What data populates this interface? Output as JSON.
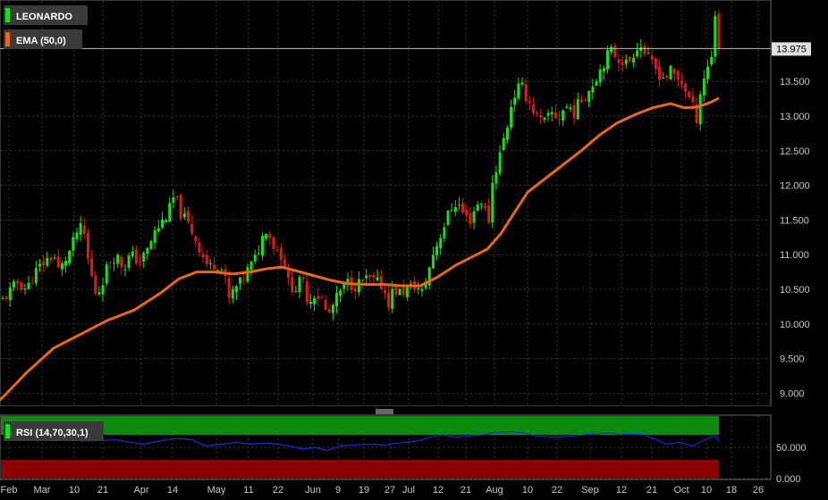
{
  "chart_data": [
    {
      "type": "candlestick",
      "symbol": "LEONARDO",
      "overlay_label": "EMA (50,0)",
      "last_price": "13.975",
      "ylim": [
        8.85,
        14.65
      ],
      "yticks": [
        "9.000",
        "9.500",
        "10.000",
        "10.500",
        "11.000",
        "11.500",
        "12.000",
        "12.500",
        "13.000",
        "13.500"
      ],
      "ytick_values": [
        9.0,
        9.5,
        10.0,
        10.5,
        11.0,
        11.5,
        12.0,
        12.5,
        13.0,
        13.5
      ],
      "xticks": [
        "Feb",
        "Mar",
        "10",
        "21",
        "Apr",
        "14",
        "May",
        "11",
        "22",
        "Jun",
        "9",
        "19",
        "27",
        "Jul",
        "12",
        "21",
        "Aug",
        "10",
        "22",
        "Sep",
        "12",
        "21",
        "Oct",
        "10",
        "18",
        "26"
      ],
      "colors": {
        "up": "#18e018",
        "down": "#e01818",
        "ema": "#e8671c",
        "grid": "#3a3a3a"
      },
      "close_path": [
        [
          0,
          10.3
        ],
        [
          10,
          10.45
        ],
        [
          20,
          10.6
        ],
        [
          30,
          10.5
        ],
        [
          40,
          10.75
        ],
        [
          50,
          10.9
        ],
        [
          60,
          11.0
        ],
        [
          66,
          10.75
        ],
        [
          72,
          10.9
        ],
        [
          80,
          11.1
        ],
        [
          88,
          11.4
        ],
        [
          94,
          11.3
        ],
        [
          100,
          10.8
        ],
        [
          108,
          10.4
        ],
        [
          114,
          10.6
        ],
        [
          122,
          10.9
        ],
        [
          130,
          11.0
        ],
        [
          138,
          10.8
        ],
        [
          146,
          11.0
        ],
        [
          155,
          10.9
        ],
        [
          163,
          11.0
        ],
        [
          172,
          11.3
        ],
        [
          180,
          11.45
        ],
        [
          188,
          11.6
        ],
        [
          195,
          11.85
        ],
        [
          202,
          11.6
        ],
        [
          210,
          11.45
        ],
        [
          218,
          11.25
        ],
        [
          226,
          11.0
        ],
        [
          234,
          10.8
        ],
        [
          242,
          10.9
        ],
        [
          250,
          10.75
        ],
        [
          256,
          10.35
        ],
        [
          262,
          10.5
        ],
        [
          270,
          10.6
        ],
        [
          278,
          10.8
        ],
        [
          286,
          10.95
        ],
        [
          292,
          11.2
        ],
        [
          298,
          11.4
        ],
        [
          305,
          11.15
        ],
        [
          312,
          11.05
        ],
        [
          318,
          10.9
        ],
        [
          322,
          10.6
        ],
        [
          330,
          10.5
        ],
        [
          338,
          10.65
        ],
        [
          345,
          10.3
        ],
        [
          352,
          10.45
        ],
        [
          360,
          10.35
        ],
        [
          366,
          10.1
        ],
        [
          372,
          10.25
        ],
        [
          380,
          10.45
        ],
        [
          388,
          10.6
        ],
        [
          396,
          10.55
        ],
        [
          404,
          10.6
        ],
        [
          412,
          10.65
        ],
        [
          420,
          10.6
        ],
        [
          428,
          10.55
        ],
        [
          434,
          10.3
        ],
        [
          440,
          10.5
        ],
        [
          448,
          10.45
        ],
        [
          456,
          10.5
        ],
        [
          464,
          10.55
        ],
        [
          472,
          10.45
        ],
        [
          478,
          10.7
        ],
        [
          484,
          11.0
        ],
        [
          490,
          11.2
        ],
        [
          496,
          11.4
        ],
        [
          502,
          11.6
        ],
        [
          508,
          11.75
        ],
        [
          514,
          11.7
        ],
        [
          520,
          11.55
        ],
        [
          526,
          11.5
        ],
        [
          532,
          11.7
        ],
        [
          540,
          11.8
        ],
        [
          546,
          11.4
        ],
        [
          550,
          12.0
        ],
        [
          556,
          12.3
        ],
        [
          562,
          12.6
        ],
        [
          568,
          12.9
        ],
        [
          572,
          13.2
        ],
        [
          577,
          13.35
        ],
        [
          582,
          13.45
        ],
        [
          588,
          13.3
        ],
        [
          594,
          13.15
        ],
        [
          600,
          13.0
        ],
        [
          606,
          12.9
        ],
        [
          612,
          12.95
        ],
        [
          618,
          13.05
        ],
        [
          624,
          12.95
        ],
        [
          630,
          13.1
        ],
        [
          636,
          13.15
        ],
        [
          642,
          13.05
        ],
        [
          648,
          13.2
        ],
        [
          654,
          13.3
        ],
        [
          660,
          13.4
        ],
        [
          666,
          13.55
        ],
        [
          672,
          13.7
        ],
        [
          678,
          13.85
        ],
        [
          684,
          13.95
        ],
        [
          690,
          13.85
        ],
        [
          696,
          13.8
        ],
        [
          702,
          13.75
        ],
        [
          708,
          13.9
        ],
        [
          714,
          14.05
        ],
        [
          720,
          13.95
        ],
        [
          726,
          13.8
        ],
        [
          732,
          13.7
        ],
        [
          738,
          13.6
        ],
        [
          744,
          13.55
        ],
        [
          750,
          13.65
        ],
        [
          756,
          13.55
        ],
        [
          762,
          13.5
        ],
        [
          768,
          13.35
        ],
        [
          774,
          13.15
        ],
        [
          780,
          12.95
        ],
        [
          784,
          13.45
        ],
        [
          790,
          13.65
        ],
        [
          796,
          13.9
        ],
        [
          800,
          14.5
        ],
        [
          804,
          13.98
        ]
      ],
      "ema_series": [
        [
          0,
          8.9
        ],
        [
          30,
          9.3
        ],
        [
          60,
          9.65
        ],
        [
          90,
          9.85
        ],
        [
          120,
          10.05
        ],
        [
          150,
          10.2
        ],
        [
          180,
          10.45
        ],
        [
          200,
          10.65
        ],
        [
          220,
          10.75
        ],
        [
          240,
          10.75
        ],
        [
          260,
          10.72
        ],
        [
          280,
          10.75
        ],
        [
          300,
          10.8
        ],
        [
          315,
          10.82
        ],
        [
          330,
          10.77
        ],
        [
          350,
          10.7
        ],
        [
          370,
          10.63
        ],
        [
          390,
          10.58
        ],
        [
          410,
          10.57
        ],
        [
          430,
          10.57
        ],
        [
          450,
          10.55
        ],
        [
          470,
          10.55
        ],
        [
          490,
          10.68
        ],
        [
          510,
          10.85
        ],
        [
          530,
          10.98
        ],
        [
          545,
          11.08
        ],
        [
          560,
          11.3
        ],
        [
          575,
          11.6
        ],
        [
          590,
          11.9
        ],
        [
          610,
          12.1
        ],
        [
          630,
          12.3
        ],
        [
          650,
          12.5
        ],
        [
          670,
          12.72
        ],
        [
          690,
          12.9
        ],
        [
          710,
          13.02
        ],
        [
          730,
          13.12
        ],
        [
          750,
          13.18
        ],
        [
          765,
          13.12
        ],
        [
          780,
          13.13
        ],
        [
          795,
          13.2
        ],
        [
          804,
          13.26
        ]
      ]
    },
    {
      "type": "line",
      "indicator_label": "RSI (14,70,30,1)",
      "ylim": [
        0,
        100
      ],
      "yticks": [
        "0.000",
        "50.000"
      ],
      "ytick_values": [
        0,
        50
      ],
      "bands": {
        "overbought": 70,
        "oversold": 30
      },
      "colors": {
        "line": "#1a2bd8",
        "overbought_band": "#0c8a0c",
        "oversold_band": "#8a0000"
      },
      "values": [
        [
          90,
          60
        ],
        [
          130,
          62
        ],
        [
          160,
          55
        ],
        [
          190,
          63
        ],
        [
          200,
          64
        ],
        [
          215,
          62
        ],
        [
          230,
          52
        ],
        [
          250,
          55
        ],
        [
          265,
          58
        ],
        [
          280,
          55
        ],
        [
          300,
          57
        ],
        [
          320,
          53
        ],
        [
          340,
          47
        ],
        [
          352,
          50
        ],
        [
          366,
          45
        ],
        [
          380,
          52
        ],
        [
          400,
          54
        ],
        [
          420,
          55
        ],
        [
          430,
          53
        ],
        [
          440,
          56
        ],
        [
          455,
          58
        ],
        [
          470,
          61
        ],
        [
          480,
          66
        ],
        [
          495,
          70
        ],
        [
          510,
          66
        ],
        [
          525,
          68
        ],
        [
          540,
          70
        ],
        [
          555,
          74
        ],
        [
          570,
          75
        ],
        [
          585,
          73
        ],
        [
          600,
          68
        ],
        [
          620,
          66
        ],
        [
          640,
          68
        ],
        [
          660,
          71
        ],
        [
          680,
          73
        ],
        [
          700,
          71
        ],
        [
          720,
          70
        ],
        [
          735,
          62
        ],
        [
          745,
          55
        ],
        [
          760,
          58
        ],
        [
          775,
          52
        ],
        [
          785,
          60
        ],
        [
          795,
          66
        ],
        [
          800,
          68
        ],
        [
          804,
          60
        ]
      ]
    }
  ]
}
